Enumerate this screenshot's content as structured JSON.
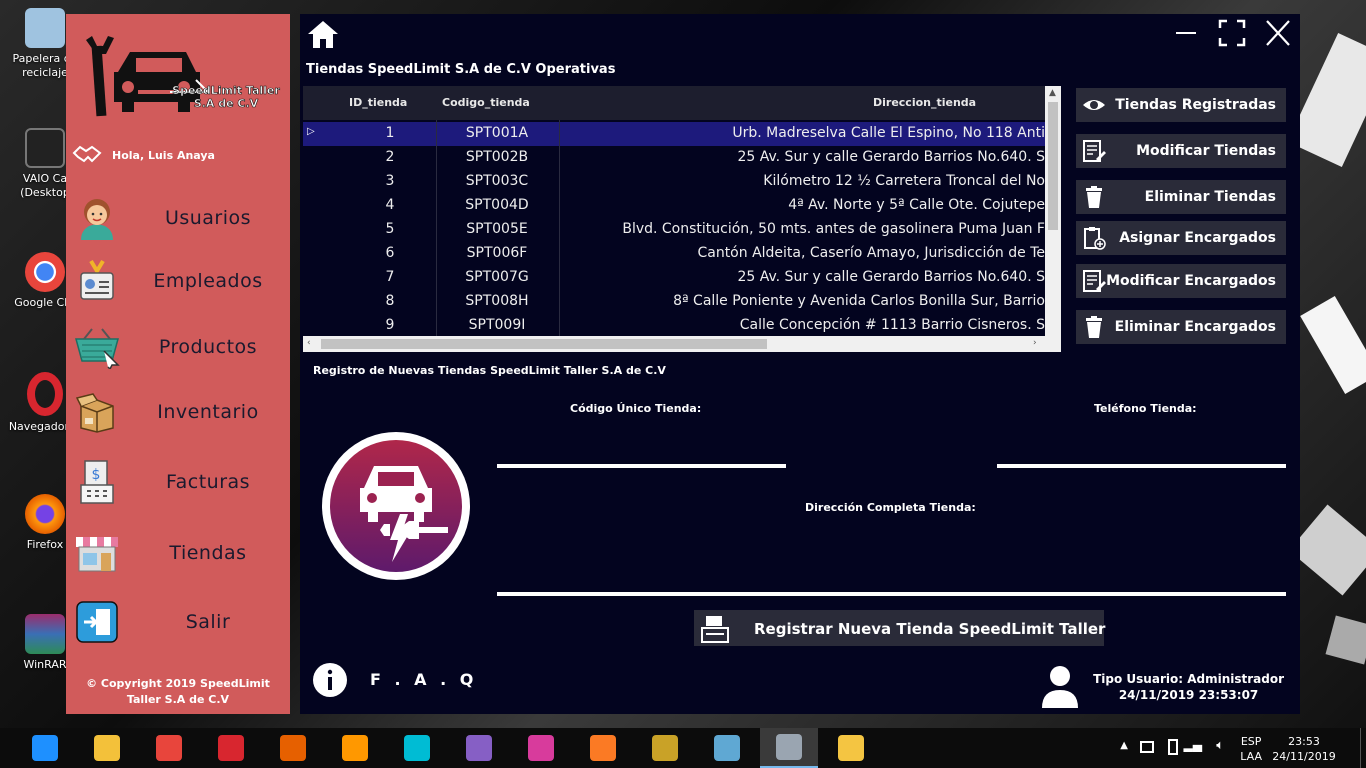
{
  "desktop": {
    "icons": [
      {
        "label": "Papelera de\nreciclaje",
        "color": "#9fc3e0"
      },
      {
        "label": "VAIO Ca\n(Desktop",
        "color": "#222"
      },
      {
        "label": "Google Chr",
        "color": "#e8453c"
      },
      {
        "label": "Navegador O",
        "color": "#d8262f"
      },
      {
        "label": "Firefox",
        "color": "#e66000"
      },
      {
        "label": "WinRAR",
        "color": "#9b2d6c"
      }
    ]
  },
  "sidebar": {
    "brand": "SpeedLimit Taller\nS.A de C.V",
    "greeting": "Hola, Luis Anaya",
    "items": [
      {
        "label": "Usuarios"
      },
      {
        "label": "Empleados"
      },
      {
        "label": "Productos"
      },
      {
        "label": "Inventario"
      },
      {
        "label": "Facturas"
      },
      {
        "label": "Tiendas"
      },
      {
        "label": "Salir"
      }
    ],
    "copyright": "© Copyright 2019 SpeedLimit\nTaller S.A de C.V"
  },
  "main": {
    "section_title": "Tiendas SpeedLimit S.A de C.V Operativas",
    "grid": {
      "columns": [
        "ID_tienda",
        "Codigo_tienda",
        "Direccion_tienda"
      ],
      "rows": [
        {
          "id": "1",
          "codigo": "SPT001A",
          "direccion": "Urb. Madreselva Calle El Espino, No 118 Anti"
        },
        {
          "id": "2",
          "codigo": "SPT002B",
          "direccion": "25 Av. Sur y calle Gerardo Barrios No.640. S"
        },
        {
          "id": "3",
          "codigo": "SPT003C",
          "direccion": "Kilómetro 12 ½ Carretera Troncal del No"
        },
        {
          "id": "4",
          "codigo": "SPT004D",
          "direccion": "4ª Av. Norte y 5ª Calle Ote. Cojutepe"
        },
        {
          "id": "5",
          "codigo": "SPT005E",
          "direccion": "Blvd. Constitución, 50 mts. antes de gasolinera Puma Juan F"
        },
        {
          "id": "6",
          "codigo": "SPT006F",
          "direccion": "Cantón Aldeita, Caserío Amayo, Jurisdicción de Te"
        },
        {
          "id": "7",
          "codigo": "SPT007G",
          "direccion": "25 Av. Sur y calle Gerardo Barrios No.640. S"
        },
        {
          "id": "8",
          "codigo": "SPT008H",
          "direccion": "8ª Calle Poniente y Avenida Carlos Bonilla Sur, Barrio"
        },
        {
          "id": "9",
          "codigo": "SPT009I",
          "direccion": "Calle Concepción # 1113 Barrio Cisneros. S"
        }
      ]
    },
    "actions": [
      {
        "label": "Tiendas Registradas",
        "icon": "eye-icon"
      },
      {
        "label": "Modificar Tiendas",
        "icon": "edit-list-icon"
      },
      {
        "label": "Eliminar Tiendas",
        "icon": "trash-icon"
      },
      {
        "label": "Asignar Encargados",
        "icon": "clipboard-add-icon"
      },
      {
        "label": "Modificar Encargados",
        "icon": "edit-list-icon"
      },
      {
        "label": "Eliminar Encargados",
        "icon": "trash-icon"
      }
    ],
    "form": {
      "title": "Registro de Nuevas Tiendas SpeedLimit Taller S.A de C.V",
      "codigo_label": "Código Único Tienda:",
      "codigo_value": "",
      "telefono_label": "Teléfono Tienda:",
      "telefono_value": "",
      "direccion_label": "Dirección Completa Tienda:",
      "direccion_value": "",
      "register_label": "Registrar Nueva Tienda SpeedLimit Taller"
    },
    "faq_label": "F . A . Q",
    "user_type": "Tipo Usuario: Administrador",
    "datetime": "24/11/2019 23:53:07"
  },
  "colors": {
    "sidebar": "#d15b5b",
    "main_bg": "#03041f",
    "button_bg": "#2a2b39",
    "selected_row": "#1d1a7c",
    "logo_gradient_top": "#b0274a",
    "logo_gradient_bottom": "#5e1a6b"
  },
  "taskbar": {
    "apps": [
      "Internet Explorer",
      "File Explorer",
      "Google Chrome",
      "Opera",
      "Firefox",
      "Sublime Text",
      "Sourcetree",
      "Visual Studio",
      "Microsoft Store",
      "XAMPP",
      "Tools",
      "VirtualBox",
      "Connector",
      "Paint"
    ],
    "lang": "ESP",
    "layout": "LAA",
    "time": "23:53",
    "date": "24/11/2019"
  }
}
